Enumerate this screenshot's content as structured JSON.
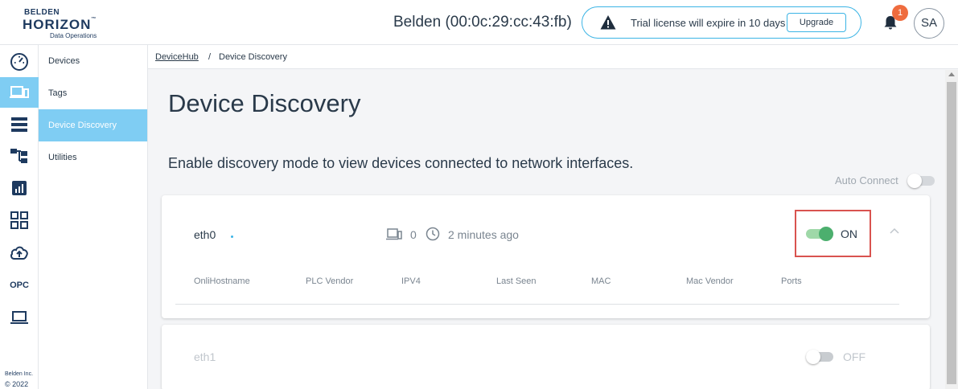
{
  "header": {
    "logo": {
      "line1": "BELDEN",
      "line2": "HORIZON",
      "tm": "™",
      "line3": "Data Operations"
    },
    "device_title": "Belden (00:0c:29:cc:43:fb)",
    "trial_message": "Trial license will expire in 10 days",
    "upgrade_label": "Upgrade",
    "notification_count": "1",
    "user_initials": "SA"
  },
  "rail": {
    "items": [
      {
        "icon": "dashboard-gauge-icon"
      },
      {
        "icon": "devices-icon",
        "active": true
      },
      {
        "icon": "list-icon"
      },
      {
        "icon": "hierarchy-icon"
      },
      {
        "icon": "analytics-icon"
      },
      {
        "icon": "apps-grid-icon"
      },
      {
        "icon": "cloud-upload-icon"
      },
      {
        "label": "OPC"
      },
      {
        "icon": "laptop-icon"
      }
    ],
    "footer_company": "Belden Inc.",
    "footer_copyright": "© 2022"
  },
  "subnav": {
    "items": [
      {
        "label": "Devices"
      },
      {
        "label": "Tags"
      },
      {
        "label": "Device Discovery",
        "active": true
      },
      {
        "label": "Utilities"
      }
    ]
  },
  "breadcrumb": {
    "parent": "DeviceHub",
    "separator": "/",
    "current": "Device Discovery"
  },
  "page": {
    "title": "Device Discovery",
    "description": "Enable discovery mode to view devices connected to network interfaces.",
    "auto_connect_label": "Auto Connect"
  },
  "interfaces": [
    {
      "name": "eth0",
      "device_count": "0",
      "last_seen": "2 minutes ago",
      "status": "ON",
      "columns": [
        "OnliHostname",
        "PLC Vendor",
        "IPV4",
        "Last Seen",
        "MAC",
        "Mac Vendor",
        "Ports"
      ]
    },
    {
      "name": "eth1",
      "status": "OFF"
    }
  ],
  "colors": {
    "accent": "#7fcdf3",
    "border_accent": "#3bb4e5",
    "toggle_on": "#4caf6e",
    "badge": "#ef6c3e",
    "highlight": "#d9534f"
  }
}
